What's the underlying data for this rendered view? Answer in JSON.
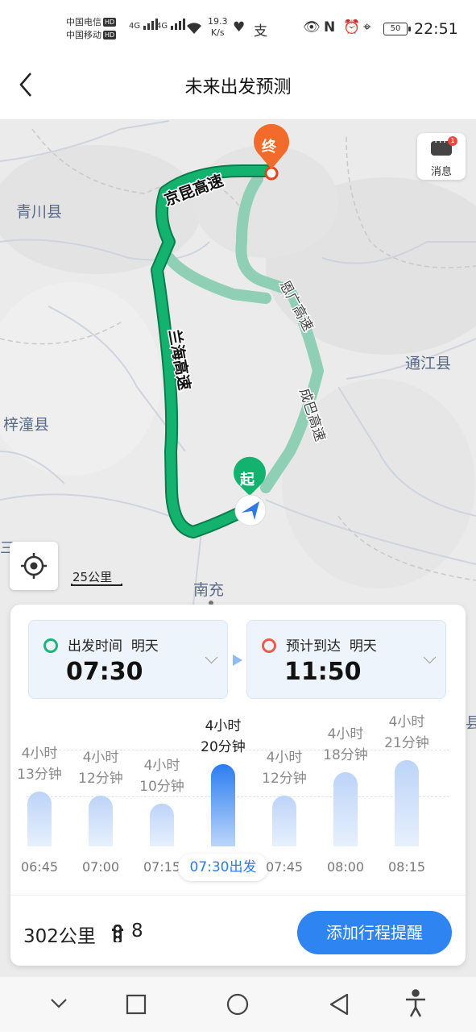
{
  "status_bar": {
    "carrier1": "中国电信",
    "carrier2": "中国移动",
    "hd": "HD",
    "net1": "4G",
    "net2": "4G",
    "speed_value": "19.3",
    "speed_unit": "K/s",
    "battery": "50",
    "time": "22:51"
  },
  "header": {
    "title": "未来出发预测"
  },
  "map": {
    "labels": {
      "qingchuan": "青川县",
      "tongjiang": "通江县",
      "zitong": "梓潼县",
      "nanchong": "南充",
      "edge_san": "三",
      "edge_xian": "县"
    },
    "roads": {
      "jingkun": "京昆高速",
      "lanhai": "兰海高速",
      "enguang": "恩广高速",
      "chengba": "成巴高速"
    },
    "start_marker": "起",
    "end_marker": "终",
    "message_label": "消息",
    "message_badge": "1",
    "scale": "25公里",
    "colors": {
      "primary_route": "#13b36f",
      "alt_route": "#8fcfb5",
      "end_marker": "#f26b2b"
    }
  },
  "panel": {
    "depart": {
      "label": "出发时间",
      "day": "明天",
      "time": "07:30"
    },
    "arrive": {
      "label": "预计到达",
      "day": "明天",
      "time": "11:50"
    },
    "options": [
      {
        "time": "06:45",
        "duration": "4小时",
        "minutes": "13分钟",
        "value_min": 253
      },
      {
        "time": "07:00",
        "duration": "4小时",
        "minutes": "12分钟",
        "value_min": 252
      },
      {
        "time": "07:15",
        "duration": "4小时",
        "minutes": "10分钟",
        "value_min": 250
      },
      {
        "time": "07:30出发",
        "duration": "4小时",
        "minutes": "20分钟",
        "value_min": 260,
        "selected": true
      },
      {
        "time": "07:45",
        "duration": "4小时",
        "minutes": "12分钟",
        "value_min": 252
      },
      {
        "time": "08:00",
        "duration": "4小时",
        "minutes": "18分钟",
        "value_min": 258
      },
      {
        "time": "08:15",
        "duration": "4小时",
        "minutes": "21分钟",
        "value_min": 261
      }
    ],
    "distance": "302公里",
    "traffic_lights": "8",
    "add_button": "添加行程提醒"
  }
}
